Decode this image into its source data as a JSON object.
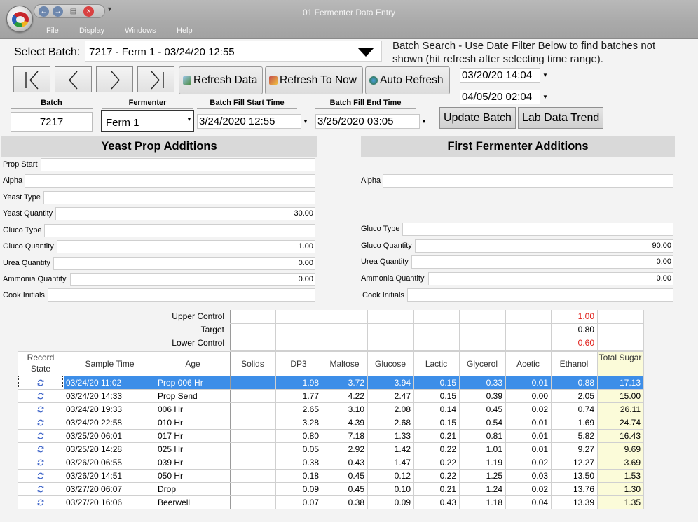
{
  "window": {
    "title": "01 Fermenter Data Entry",
    "menu": [
      "File",
      "Display",
      "Windows",
      "Help"
    ]
  },
  "batch_select": {
    "label": "Select Batch:",
    "value": "7217 - Ferm 1 - 03/24/20 12:55",
    "hint": "Batch Search - Use Date Filter Below to find batches not shown (hit refresh after selecting time range)."
  },
  "toolbar": {
    "refresh_data": "Refresh Data",
    "refresh_to_now": "Refresh To Now",
    "auto_refresh": "Auto Refresh",
    "date_from": "03/20/20 14:04",
    "date_to": "04/05/20 02:04",
    "update_batch": "Update Batch",
    "lab_data_trend": "Lab Data Trend"
  },
  "batch_info": {
    "batch_label": "Batch",
    "batch_value": "7217",
    "fermenter_label": "Fermenter",
    "fermenter_value": "Ferm 1",
    "fill_start_label": "Batch Fill Start Time",
    "fill_start_value": "3/24/2020 12:55",
    "fill_end_label": "Batch Fill End Time",
    "fill_end_value": "3/25/2020 03:05"
  },
  "yeast_prop": {
    "title": "Yeast Prop Additions",
    "fields": [
      {
        "label": "Prop Start",
        "value": ""
      },
      {
        "label": "Alpha",
        "value": ""
      },
      {
        "label": "Yeast Type",
        "value": ""
      },
      {
        "label": "Yeast Quantity",
        "value": "30.00"
      },
      {
        "label": "Gluco Type",
        "value": ""
      },
      {
        "label": "Gluco Quantity",
        "value": "1.00"
      },
      {
        "label": "Urea Quantity",
        "value": "0.00"
      },
      {
        "label": "Ammonia Quantity",
        "value": "0.00"
      },
      {
        "label": "Cook Initials",
        "value": ""
      }
    ]
  },
  "first_fermenter": {
    "title": "First Fermenter Additions",
    "fields": [
      {
        "label": "Alpha",
        "value": ""
      },
      {
        "label": "Gluco Type",
        "value": ""
      },
      {
        "label": "Gluco Quantity",
        "value": "90.00"
      },
      {
        "label": "Urea Quantity",
        "value": "0.00"
      },
      {
        "label": "Ammonia Quantity",
        "value": "0.00"
      },
      {
        "label": "Cook Initials",
        "value": ""
      }
    ]
  },
  "controls": {
    "labels": [
      "Upper Control",
      "Target",
      "Lower Control"
    ],
    "ethanol": [
      "1.00",
      "0.80",
      "0.60"
    ],
    "colors": {
      "upper": "#e0201b",
      "target": "#000000",
      "lower": "#e0201b"
    }
  },
  "table": {
    "columns": [
      "Record State",
      "Sample Time",
      "Age",
      "Solids",
      "DP3",
      "Maltose",
      "Glucose",
      "Lactic",
      "Glycerol",
      "Acetic",
      "Ethanol",
      "Total Sugar"
    ],
    "rows": [
      [
        "03/24/20 11:02",
        "Prop 006 Hr",
        "",
        "1.98",
        "3.72",
        "3.94",
        "0.15",
        "0.33",
        "0.01",
        "0.88",
        "17.13"
      ],
      [
        "03/24/20 14:33",
        "Prop Send",
        "",
        "1.77",
        "4.22",
        "2.47",
        "0.15",
        "0.39",
        "0.00",
        "2.05",
        "15.00"
      ],
      [
        "03/24/20 19:33",
        "006 Hr",
        "",
        "2.65",
        "3.10",
        "2.08",
        "0.14",
        "0.45",
        "0.02",
        "0.74",
        "26.11"
      ],
      [
        "03/24/20 22:58",
        "010 Hr",
        "",
        "3.28",
        "4.39",
        "2.68",
        "0.15",
        "0.54",
        "0.01",
        "1.69",
        "24.74"
      ],
      [
        "03/25/20 06:01",
        "017 Hr",
        "",
        "0.80",
        "7.18",
        "1.33",
        "0.21",
        "0.81",
        "0.01",
        "5.82",
        "16.43"
      ],
      [
        "03/25/20 14:28",
        "025 Hr",
        "",
        "0.05",
        "2.92",
        "1.42",
        "0.22",
        "1.01",
        "0.01",
        "9.27",
        "9.69"
      ],
      [
        "03/26/20 06:55",
        "039 Hr",
        "",
        "0.38",
        "0.43",
        "1.47",
        "0.22",
        "1.19",
        "0.02",
        "12.27",
        "3.69"
      ],
      [
        "03/26/20 14:51",
        "050 Hr",
        "",
        "0.18",
        "0.45",
        "0.12",
        "0.22",
        "1.25",
        "0.03",
        "13.50",
        "1.53"
      ],
      [
        "03/27/20 06:07",
        "Drop",
        "",
        "0.09",
        "0.45",
        "0.10",
        "0.21",
        "1.24",
        "0.02",
        "13.76",
        "1.30"
      ],
      [
        "03/27/20 16:06",
        "Beerwell",
        "",
        "0.07",
        "0.38",
        "0.09",
        "0.43",
        "1.18",
        "0.04",
        "13.39",
        "1.35"
      ]
    ],
    "selected_row": 0,
    "colors": {
      "selected": "#3d8ee8",
      "total_sugar_bg": "#fbfbd9",
      "record_icon": "#3c63c8"
    },
    "record_icon": "sync-icon"
  }
}
